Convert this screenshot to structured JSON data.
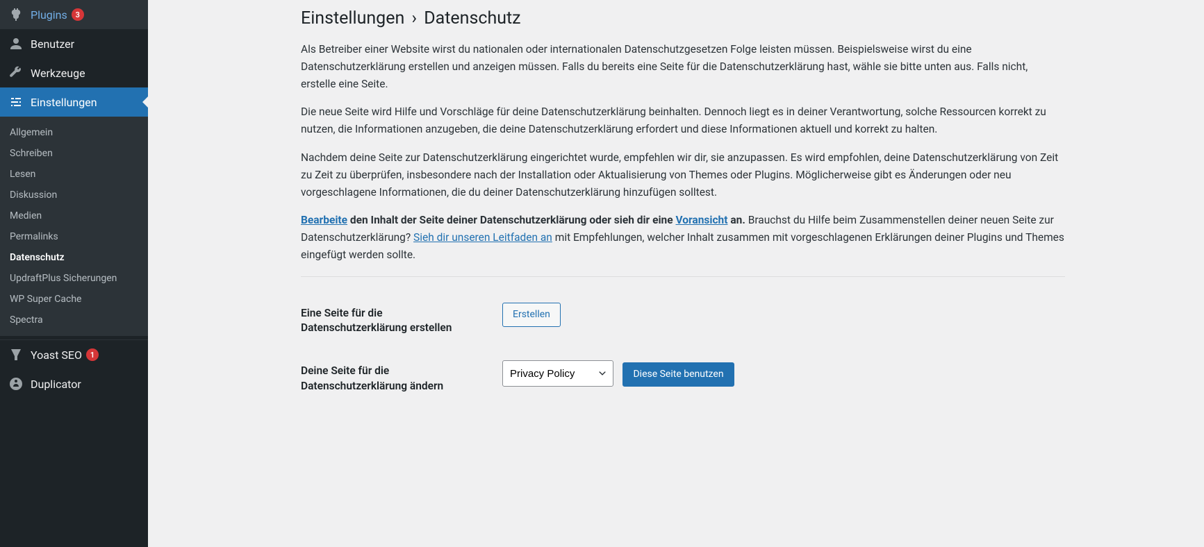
{
  "sidebar": {
    "plugins": {
      "label": "Plugins",
      "badge": "3"
    },
    "users": {
      "label": "Benutzer"
    },
    "tools": {
      "label": "Werkzeuge"
    },
    "settings": {
      "label": "Einstellungen"
    },
    "submenu": {
      "general": "Allgemein",
      "writing": "Schreiben",
      "reading": "Lesen",
      "discussion": "Diskussion",
      "media": "Medien",
      "permalinks": "Permalinks",
      "privacy": "Datenschutz",
      "updraft": "UpdraftPlus Sicherungen",
      "wpsc": "WP Super Cache",
      "spectra": "Spectra"
    },
    "yoast": {
      "label": "Yoast SEO",
      "badge": "1"
    },
    "duplicator": {
      "label": "Duplicator"
    }
  },
  "page": {
    "heading_prefix": "Einstellungen",
    "heading_sep": "›",
    "heading_current": "Datenschutz",
    "p1": "Als Betreiber einer Website wirst du nationalen oder internationalen Datenschutzgesetzen Folge leisten müssen. Beispielsweise wirst du eine Datenschutzerklärung erstellen und anzeigen müssen. Falls du bereits eine Seite für die Datenschutzerklärung hast, wähle sie bitte unten aus. Falls nicht, erstelle eine Seite.",
    "p2": "Die neue Seite wird Hilfe und Vorschläge für deine Datenschutzerklärung beinhalten. Dennoch liegt es in deiner Verantwortung, solche Ressourcen korrekt zu nutzen, die Informationen anzugeben, die deine Datenschutzerklärung erfordert und diese Informationen aktuell und korrekt zu halten.",
    "p3": "Nachdem deine Seite zur Datenschutzerklärung eingerichtet wurde, empfehlen wir dir, sie anzupassen. Es wird empfohlen, deine Datenschutzerklärung von Zeit zu Zeit zu überprüfen, insbesondere nach der Installation oder Aktualisierung von Themes oder Plugins. Möglicherweise gibt es Änderungen oder neu vorgeschlagene Informationen, die du deiner Datenschutzerklärung hinzufügen solltest.",
    "p4": {
      "link_edit": "Bearbeite",
      "mid1": " den Inhalt der Seite deiner Datenschutzerklärung oder sieh dir eine ",
      "link_preview": "Voransicht",
      "mid2": " an.",
      "after": " Brauchst du Hilfe beim Zusammenstellen deiner neuen Seite zur Datenschutzerklärung? ",
      "link_guide": "Sieh dir unseren Leitfaden an",
      "tail": " mit Empfehlungen, welcher Inhalt zusammen mit vorgeschlagenen Erklärungen deiner Plugins und Themes eingefügt werden sollte."
    },
    "row_create_label": "Eine Seite für die Datenschutzerklärung erstellen",
    "create_button": "Erstellen",
    "row_change_label": "Deine Seite für die Datenschutzerklärung ändern",
    "select_value": "Privacy Policy",
    "use_button": "Diese Seite benutzen"
  }
}
